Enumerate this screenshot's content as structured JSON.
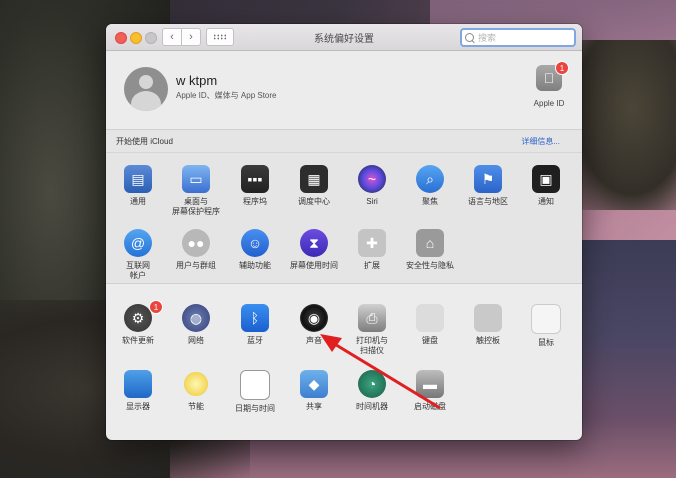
{
  "window": {
    "title": "系统偏好设置",
    "search_placeholder": "搜索"
  },
  "account": {
    "username": "w ktpm",
    "subtitle": "Apple ID、媒体与 App Store",
    "apple_id_label": "Apple ID",
    "apple_id_badge": "1"
  },
  "icloud": {
    "text": "开始使用 iCloud",
    "link": "详细信息..."
  },
  "section1": {
    "items": [
      {
        "label": "通用",
        "icon": "general-icon"
      },
      {
        "label": "桌面与\n屏幕保护程序",
        "icon": "desktop-icon"
      },
      {
        "label": "程序坞",
        "icon": "dock-icon"
      },
      {
        "label": "调度中心",
        "icon": "mission-control-icon"
      },
      {
        "label": "Siri",
        "icon": "siri-icon"
      },
      {
        "label": "聚焦",
        "icon": "spotlight-icon"
      },
      {
        "label": "语言与地区",
        "icon": "language-icon"
      },
      {
        "label": "通知",
        "icon": "notifications-icon"
      },
      {
        "label": "互联网\n帐户",
        "icon": "internet-accounts-icon"
      },
      {
        "label": "用户与群组",
        "icon": "users-icon"
      },
      {
        "label": "辅助功能",
        "icon": "accessibility-icon"
      },
      {
        "label": "屏幕使用时间",
        "icon": "screen-time-icon"
      },
      {
        "label": "扩展",
        "icon": "extensions-icon"
      },
      {
        "label": "安全性与隐私",
        "icon": "security-icon"
      }
    ]
  },
  "section2": {
    "items": [
      {
        "label": "软件更新",
        "icon": "software-update-icon",
        "badge": "1"
      },
      {
        "label": "网络",
        "icon": "network-icon"
      },
      {
        "label": "蓝牙",
        "icon": "bluetooth-icon"
      },
      {
        "label": "声音",
        "icon": "sound-icon"
      },
      {
        "label": "打印机与\n扫描仪",
        "icon": "printer-icon"
      },
      {
        "label": "键盘",
        "icon": "keyboard-icon"
      },
      {
        "label": "触控板",
        "icon": "trackpad-icon"
      },
      {
        "label": "鼠标",
        "icon": "mouse-icon"
      },
      {
        "label": "显示器",
        "icon": "display-icon"
      },
      {
        "label": "节能",
        "icon": "energy-saver-icon"
      },
      {
        "label": "日期与时间",
        "icon": "date-time-icon"
      },
      {
        "label": "共享",
        "icon": "sharing-icon"
      },
      {
        "label": "时间机器",
        "icon": "time-machine-icon"
      },
      {
        "label": "启动磁盘",
        "icon": "startup-disk-icon"
      }
    ]
  },
  "colors": {
    "accent": "#2a62c9",
    "annotation_arrow": "#e02020",
    "badge": "#e8463f"
  }
}
